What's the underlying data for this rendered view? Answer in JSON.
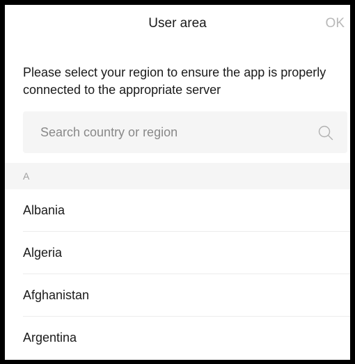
{
  "header": {
    "title": "User area",
    "ok_label": "OK"
  },
  "description": "Please select your region to ensure the app is properly connected to the appropriate server",
  "search": {
    "placeholder": "Search country or region",
    "icon": "search-icon"
  },
  "section": {
    "letter": "A"
  },
  "countries": [
    "Albania",
    "Algeria",
    "Afghanistan",
    "Argentina"
  ],
  "colors": {
    "frame": "#000000",
    "background": "#ffffff",
    "search_background": "#f5f5f5",
    "ok_disabled": "#b8b8b8",
    "text": "#1a1a1a",
    "divider": "#ececec"
  }
}
